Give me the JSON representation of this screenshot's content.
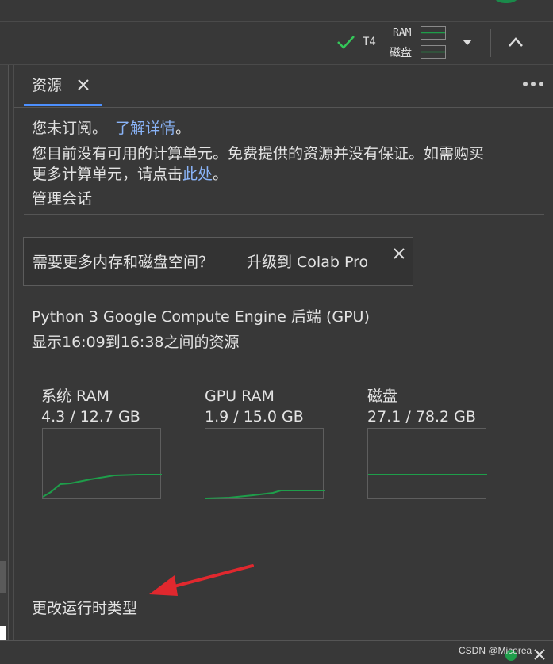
{
  "toolbar": {
    "gpu_label": "T4",
    "ram_label": "RAM",
    "disk_label": "磁盘"
  },
  "panel": {
    "tab_label": "资源",
    "not_subscribed": "您未订阅。",
    "learn_more": "了解详情",
    "period": "。",
    "no_units_line1": "您目前没有可用的计算单元。免费提供的资源并没有保证。如需购买",
    "no_units_line2_prefix": "更多计算单元，请点击",
    "click_here": "此处",
    "no_units_line2_suffix": "。",
    "manage_sessions": "管理会话",
    "banner_question": "需要更多内存和磁盘空间？",
    "banner_upgrade": "升级到 Colab Pro",
    "backend": "Python 3 Google Compute Engine 后端 (GPU)",
    "time_range": "显示16:09到16:38之间的资源",
    "change_runtime": "更改运行时类型"
  },
  "meters": [
    {
      "label": "系统 RAM",
      "value": "4.3 / 12.7 GB",
      "used": 4.3,
      "total": 12.7
    },
    {
      "label": "GPU RAM",
      "value": "1.9 / 15.0 GB",
      "used": 1.9,
      "total": 15.0
    },
    {
      "label": "磁盘",
      "value": "27.1 / 78.2 GB",
      "used": 27.1,
      "total": 78.2
    }
  ],
  "watermark": "CSDN @Micorea",
  "colors": {
    "accent_blue": "#4d90fe",
    "link": "#8ab4f8",
    "graph_green": "#1e9e4a",
    "check_green": "#34c759",
    "arrow_red": "#e0282e"
  },
  "icons": [
    "check-icon",
    "ram-meter-icon",
    "disk-meter-icon",
    "dropdown-triangle-icon",
    "chevron-up-icon",
    "close-icon",
    "more-vert-icon"
  ]
}
